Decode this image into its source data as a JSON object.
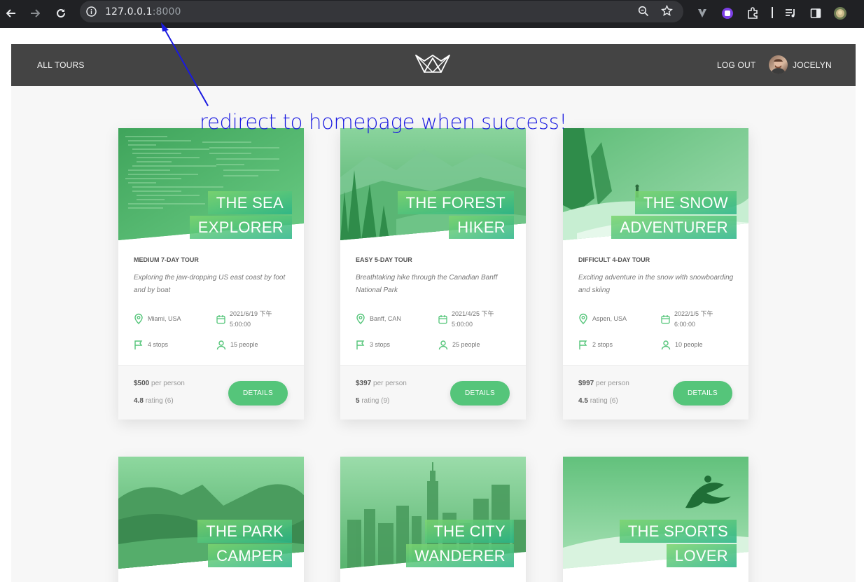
{
  "browser": {
    "url_host": "127.0.0.1",
    "url_port": ":8000"
  },
  "header": {
    "nav_all_tours": "All tours",
    "logout": "Log out",
    "user_name": "Jocelyn"
  },
  "annotation": "redirect to homepage when success!",
  "colors": {
    "accent": "#55c57a",
    "header_bg": "#444444",
    "annotation": "#1a1ae0"
  },
  "tours": [
    {
      "title_line1": "The Sea",
      "title_line2": "Explorer",
      "subheading": "Medium 7-day tour",
      "summary": "Exploring the jaw-dropping US east coast by foot and by boat",
      "location": "Miami, USA",
      "date": "2021/6/19 下午 5:00:00",
      "stops": "4 stops",
      "people": "15 people",
      "price": "$500",
      "price_unit": "per person",
      "rating": "4.8",
      "rating_label": "rating (6)",
      "button": "Details"
    },
    {
      "title_line1": "The Forest",
      "title_line2": "Hiker",
      "subheading": "Easy 5-day tour",
      "summary": "Breathtaking hike through the Canadian Banff National Park",
      "location": "Banff, CAN",
      "date": "2021/4/25 下午 5:00:00",
      "stops": "3 stops",
      "people": "25 people",
      "price": "$397",
      "price_unit": "per person",
      "rating": "5",
      "rating_label": "rating (9)",
      "button": "Details"
    },
    {
      "title_line1": "The Snow",
      "title_line2": "Adventurer",
      "subheading": "Difficult 4-day tour",
      "summary": "Exciting adventure in the snow with snowboarding and skiing",
      "location": "Aspen, USA",
      "date": "2022/1/5 下午 6:00:00",
      "stops": "2 stops",
      "people": "10 people",
      "price": "$997",
      "price_unit": "per person",
      "rating": "4.5",
      "rating_label": "rating (6)",
      "button": "Details"
    },
    {
      "title_line1": "The Park",
      "title_line2": "Camper"
    },
    {
      "title_line1": "The City",
      "title_line2": "Wanderer"
    },
    {
      "title_line1": "The Sports",
      "title_line2": "Lover"
    }
  ]
}
